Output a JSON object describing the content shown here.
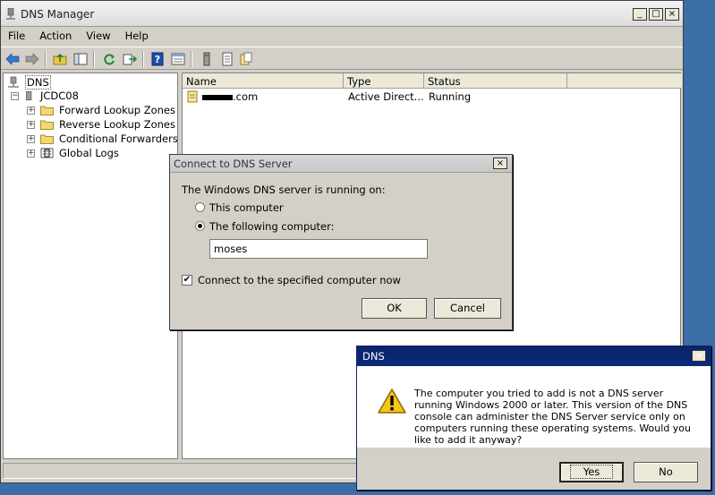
{
  "main_window": {
    "title": "DNS Manager",
    "controls": {
      "minimize": "_",
      "maximize": "□",
      "close": "×"
    }
  },
  "menu": [
    "File",
    "Action",
    "View",
    "Help"
  ],
  "toolbar_icons": [
    "back-arrow-icon",
    "forward-arrow-icon",
    "up-folder-icon",
    "show-hide-tree-icon",
    "refresh-icon",
    "export-list-icon",
    "help-icon",
    "properties-icon",
    "server-icon",
    "list-icon",
    "zone-icon"
  ],
  "tree": {
    "root": "DNS",
    "server": "JCDC08",
    "children": [
      "Forward Lookup Zones",
      "Reverse Lookup Zones",
      "Conditional Forwarders",
      "Global Logs"
    ]
  },
  "list": {
    "columns": [
      "Name",
      "Type",
      "Status"
    ],
    "rows": [
      {
        "name_suffix": ".com",
        "type": "Active Direct...",
        "status": "Running"
      }
    ]
  },
  "connect_dialog": {
    "title": "Connect to DNS Server",
    "prompt": "The Windows DNS server is running on:",
    "option_this": "This computer",
    "option_following": "The following computer:",
    "computer_value": "moses",
    "connect_now_label": "Connect to the specified computer now",
    "ok_label": "OK",
    "cancel_label": "Cancel"
  },
  "dns_dialog": {
    "title": "DNS",
    "message": "The computer you tried to add is not a DNS server running Windows 2000 or later. This version of the DNS console can administer the DNS Server service only on computers running these operating systems. Would you like to add it anyway?",
    "yes_label": "Yes",
    "no_label": "No"
  },
  "colors": {
    "desktop": "#3a6ea5",
    "active_title": "#0a246a",
    "window_face": "#d4d0c8"
  }
}
